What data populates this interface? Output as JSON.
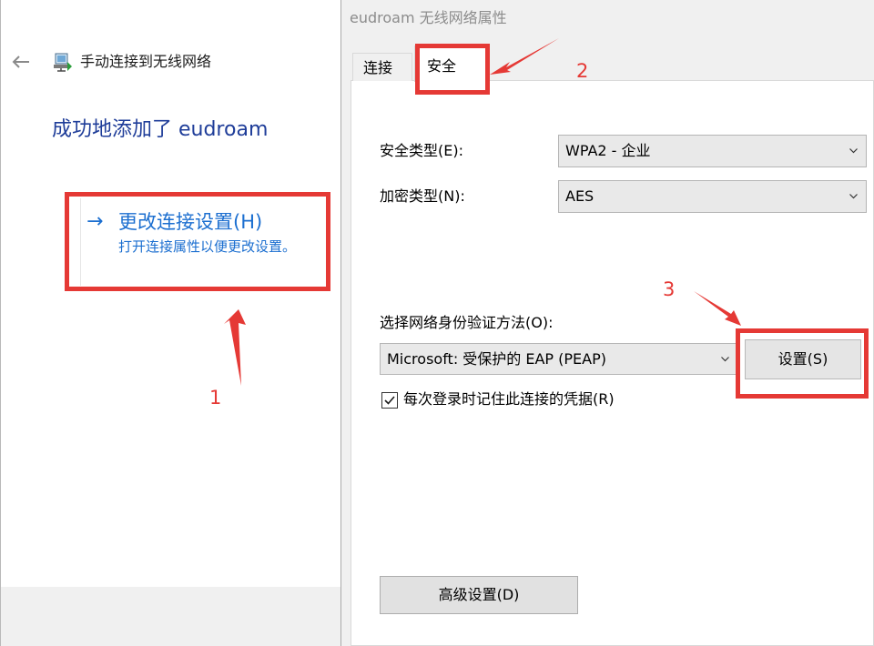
{
  "wizard": {
    "title": "手动连接到无线网络",
    "success_message": "成功地添加了 eudroam",
    "link": {
      "arrow": "→",
      "title": "更改连接设置(H)",
      "subtitle": "打开连接属性以便更改设置。"
    }
  },
  "dialog": {
    "title": "eudroam 无线网络属性",
    "tabs": [
      {
        "label": "连接"
      },
      {
        "label": "安全"
      }
    ],
    "security_type": {
      "label": "安全类型(E):",
      "value": "WPA2 - 企业"
    },
    "encryption_type": {
      "label": "加密类型(N):",
      "value": "AES"
    },
    "auth_method": {
      "label": "选择网络身份验证方法(O):",
      "value": "Microsoft: 受保护的 EAP (PEAP)"
    },
    "settings_button": "设置(S)",
    "remember_credentials": {
      "label": "每次登录时记住此连接的凭据(R)",
      "checked": true
    },
    "advanced_button": "高级设置(D)"
  },
  "annotations": {
    "step1": "1",
    "step2": "2",
    "step3": "3",
    "color": "#e53935"
  },
  "colors": {
    "link_blue": "#1c6fd0",
    "heading_blue": "#1f3d99"
  }
}
